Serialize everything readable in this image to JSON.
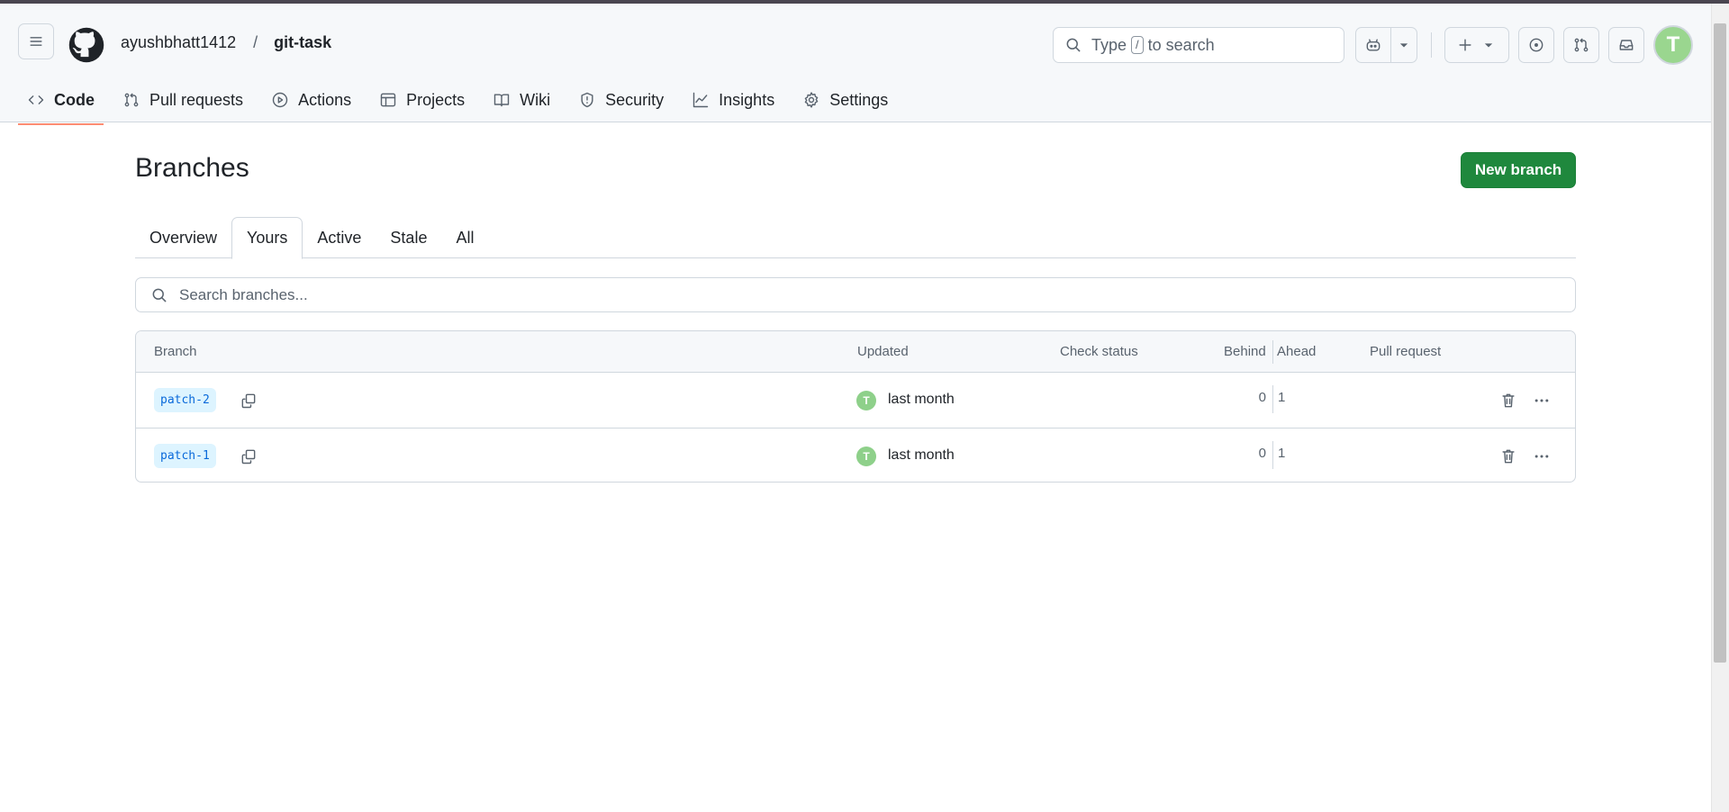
{
  "header": {
    "owner": "ayushbhatt1412",
    "separator": "/",
    "repo": "git-task",
    "search": {
      "prefix": "Type",
      "key": "/",
      "suffix": "to search"
    },
    "avatar_letter": "T"
  },
  "nav": {
    "items": [
      {
        "label": "Code",
        "icon": "code-icon",
        "active": true
      },
      {
        "label": "Pull requests",
        "icon": "git-pull-request-icon"
      },
      {
        "label": "Actions",
        "icon": "play-icon"
      },
      {
        "label": "Projects",
        "icon": "table-icon"
      },
      {
        "label": "Wiki",
        "icon": "book-icon"
      },
      {
        "label": "Security",
        "icon": "shield-icon"
      },
      {
        "label": "Insights",
        "icon": "graph-icon"
      },
      {
        "label": "Settings",
        "icon": "gear-icon"
      }
    ]
  },
  "page": {
    "title": "Branches",
    "new_branch_label": "New branch",
    "tabs": [
      "Overview",
      "Yours",
      "Active",
      "Stale",
      "All"
    ],
    "selected_tab": "Yours",
    "search_placeholder": "Search branches..."
  },
  "table": {
    "headers": {
      "branch": "Branch",
      "updated": "Updated",
      "check_status": "Check status",
      "behind": "Behind",
      "ahead": "Ahead",
      "pull_request": "Pull request"
    },
    "rows": [
      {
        "branch": "patch-2",
        "updated": "last month",
        "behind": "0",
        "ahead": "1",
        "avatar": "T"
      },
      {
        "branch": "patch-1",
        "updated": "last month",
        "behind": "0",
        "ahead": "1",
        "avatar": "T"
      }
    ]
  },
  "colors": {
    "primary_button": "#1f883d",
    "active_tab_underline": "#fd8c73",
    "branch_pill_bg": "#ddf4ff",
    "branch_pill_text": "#0969da"
  }
}
